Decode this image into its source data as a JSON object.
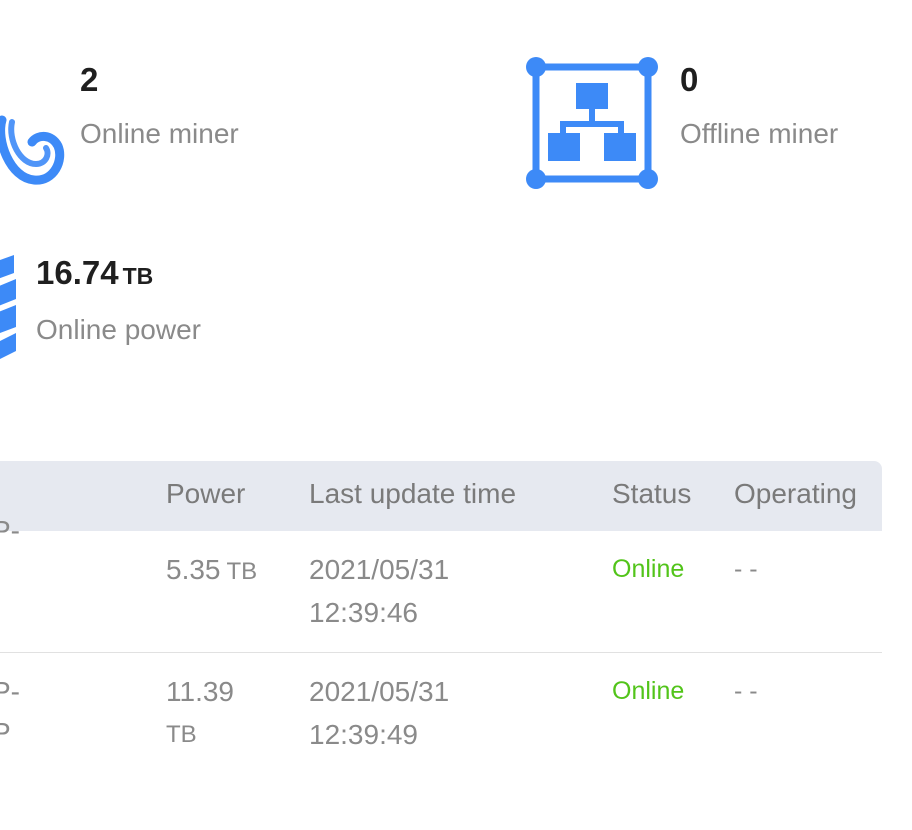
{
  "stats": {
    "online_miner": {
      "value": "2",
      "label": "Online miner"
    },
    "offline_miner": {
      "value": "0",
      "label": "Offline miner"
    },
    "online_power": {
      "value": "16.74",
      "unit": "TB",
      "label": "Online power"
    }
  },
  "table": {
    "headers": {
      "power": "Power",
      "last_update": "Last update time",
      "status": "Status",
      "operating": "Operating"
    },
    "rows": [
      {
        "name_line1": "P-",
        "name_line2": "",
        "power_value": "5.35",
        "power_unit": "TB",
        "date": "2021/05/31",
        "time": "12:39:46",
        "status": "Online",
        "operating": "- -"
      },
      {
        "name_line1": "P-",
        "name_line2": "P",
        "power_value": "11.39",
        "power_unit": "TB",
        "date": "2021/05/31",
        "time": "12:39:49",
        "status": "Online",
        "operating": "- -"
      }
    ]
  },
  "colors": {
    "icon_blue": "#3d8af7",
    "status_online": "#52c41a",
    "header_bg": "#e6e9f0"
  },
  "icons": {
    "online_miner": "link-loop-icon",
    "offline_miner": "network-hierarchy-icon",
    "online_power": "storage-stack-icon"
  }
}
